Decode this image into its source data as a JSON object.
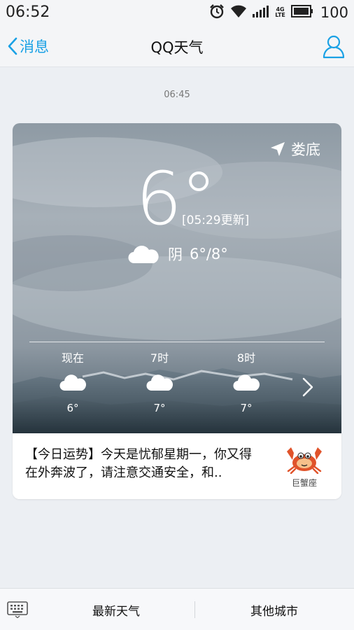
{
  "status_bar": {
    "time": "06:52",
    "network": "4G",
    "network_sub": "LTE",
    "battery": "100",
    "icons": [
      "alarm-icon",
      "wifi-icon",
      "signal-icon",
      "battery-icon"
    ]
  },
  "nav": {
    "back_label": "消息",
    "title": "QQ天气",
    "profile_icon": "person-icon"
  },
  "message_time": "06:45",
  "weather": {
    "location": "娄底",
    "temperature": "6°",
    "update_time": "[05:29更新]",
    "condition": "阴",
    "range": "6°/8°",
    "hourly": [
      {
        "label": "现在",
        "temp": "6°",
        "icon": "cloud-icon"
      },
      {
        "label": "7时",
        "temp": "7°",
        "icon": "cloud-icon"
      },
      {
        "label": "8时",
        "temp": "7°",
        "icon": "cloud-icon"
      }
    ]
  },
  "fortune": {
    "text": "【今日运势】今天是忧郁星期一，你又得在外奔波了，请注意交通安全，和..",
    "sign": "巨蟹座"
  },
  "bottom_bar": {
    "tab_latest": "最新天气",
    "tab_other": "其他城市"
  },
  "colors": {
    "accent": "#1aa1e5",
    "background": "#eceff3"
  }
}
